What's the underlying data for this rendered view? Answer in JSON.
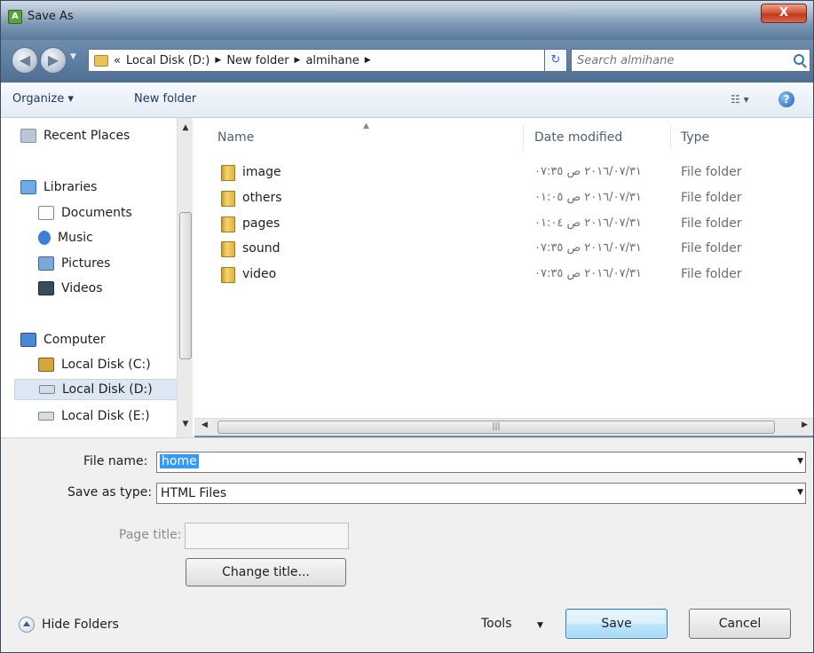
{
  "window": {
    "title": "Save As",
    "close_label": "X"
  },
  "address": {
    "overflow": "«",
    "crumbs": [
      "Local Disk (D:)",
      "New folder",
      "almihane"
    ],
    "search_placeholder": "Search almihane"
  },
  "toolbar": {
    "organize": "Organize ▾",
    "new_folder": "New folder",
    "views": "☷ ▾",
    "help": "?"
  },
  "nav": {
    "items": [
      {
        "label": "Recent Places",
        "icon": "recent-places-icon"
      },
      {
        "label": "Libraries",
        "icon": "libraries-icon"
      },
      {
        "label": "Documents",
        "icon": "documents-icon"
      },
      {
        "label": "Music",
        "icon": "music-icon"
      },
      {
        "label": "Pictures",
        "icon": "pictures-icon"
      },
      {
        "label": "Videos",
        "icon": "videos-icon"
      },
      {
        "label": "Computer",
        "icon": "computer-icon"
      },
      {
        "label": "Local Disk (C:)",
        "icon": "local-disk-c-icon"
      },
      {
        "label": "Local Disk (D:)",
        "icon": "drive-icon",
        "selected": true
      },
      {
        "label": "Local Disk (E:)",
        "icon": "drive-icon"
      }
    ]
  },
  "files": {
    "columns": {
      "name": "Name",
      "date": "Date modified",
      "type": "Type"
    },
    "rows": [
      {
        "name": "image",
        "date": "٢٠١٦/٠٧/٣١ ص ٠٧:٣٥",
        "type": "File folder"
      },
      {
        "name": "others",
        "date": "٢٠١٦/٠٧/٣١ ص ٠١:٠٥",
        "type": "File folder"
      },
      {
        "name": "pages",
        "date": "٢٠١٦/٠٧/٣١ ص ٠١:٠٤",
        "type": "File folder"
      },
      {
        "name": "sound",
        "date": "٢٠١٦/٠٧/٣١ ص ٠٧:٣٥",
        "type": "File folder"
      },
      {
        "name": "video",
        "date": "٢٠١٦/٠٧/٣١ ص ٠٧:٣٥",
        "type": "File folder"
      }
    ]
  },
  "form": {
    "file_name_label": "File name:",
    "file_name_value": "home",
    "save_type_label": "Save as type:",
    "save_type_value": "HTML Files",
    "page_title_label": "Page title:",
    "change_title_label": "Change title...",
    "hide_folders_label": "Hide Folders",
    "tools_label": "Tools",
    "save_label": "Save",
    "cancel_label": "Cancel"
  }
}
